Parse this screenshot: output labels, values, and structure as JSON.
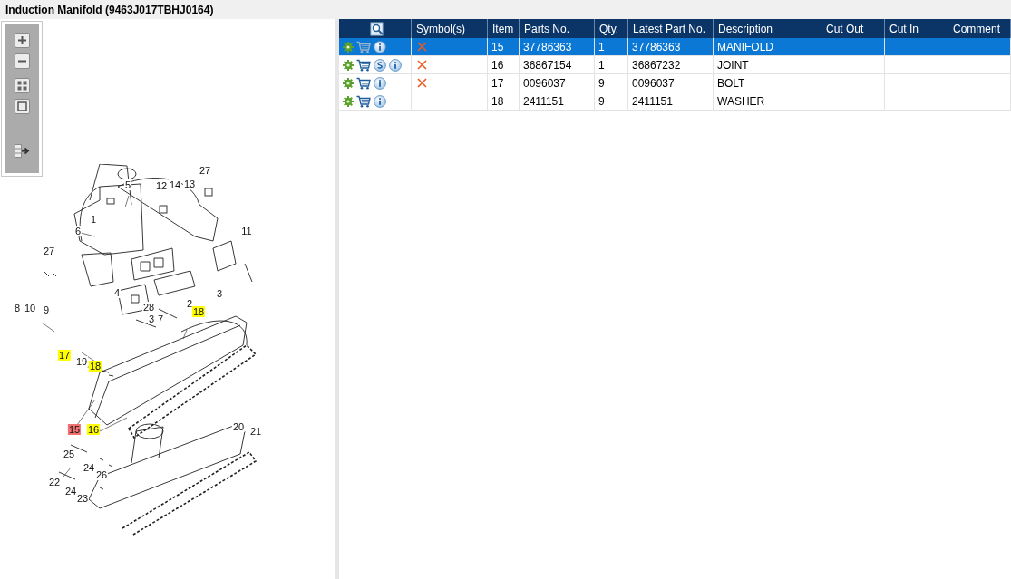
{
  "title": "Induction Manifold (9463J017TBHJ0164)",
  "callouts": [
    {
      "label": "27",
      "kind": "plain"
    },
    {
      "label": "5",
      "kind": "plain"
    },
    {
      "label": "12",
      "kind": "plain"
    },
    {
      "label": "14",
      "kind": "plain"
    },
    {
      "label": "13",
      "kind": "plain"
    },
    {
      "label": "1",
      "kind": "plain"
    },
    {
      "label": "6",
      "kind": "plain"
    },
    {
      "label": "11",
      "kind": "plain"
    },
    {
      "label": "27",
      "kind": "plain"
    },
    {
      "label": "8",
      "kind": "plain"
    },
    {
      "label": "10",
      "kind": "plain"
    },
    {
      "label": "9",
      "kind": "plain"
    },
    {
      "label": "4",
      "kind": "plain"
    },
    {
      "label": "3",
      "kind": "plain"
    },
    {
      "label": "2",
      "kind": "plain"
    },
    {
      "label": "28",
      "kind": "plain"
    },
    {
      "label": "18",
      "kind": "listed"
    },
    {
      "label": "3",
      "kind": "plain"
    },
    {
      "label": "7",
      "kind": "plain"
    },
    {
      "label": "17",
      "kind": "listed"
    },
    {
      "label": "19",
      "kind": "plain"
    },
    {
      "label": "18",
      "kind": "listed"
    },
    {
      "label": "15",
      "kind": "selected"
    },
    {
      "label": "16",
      "kind": "listed"
    },
    {
      "label": "20",
      "kind": "plain"
    },
    {
      "label": "21",
      "kind": "plain"
    },
    {
      "label": "25",
      "kind": "plain"
    },
    {
      "label": "24",
      "kind": "plain"
    },
    {
      "label": "26",
      "kind": "plain"
    },
    {
      "label": "22",
      "kind": "plain"
    },
    {
      "label": "24",
      "kind": "plain"
    },
    {
      "label": "23",
      "kind": "plain"
    }
  ],
  "table": {
    "columns": [
      "Symbol(s)",
      "Item",
      "Parts No.",
      "Qty.",
      "Latest Part No.",
      "Description",
      "Cut Out",
      "Cut In",
      "Comment"
    ],
    "rows": [
      {
        "selected": true,
        "supersession": false,
        "crossed": true,
        "item": "15",
        "part_no": "37786363",
        "qty": "1",
        "latest_part_no": "37786363",
        "description": "MANIFOLD"
      },
      {
        "selected": false,
        "supersession": true,
        "crossed": true,
        "item": "16",
        "part_no": "36867154",
        "qty": "1",
        "latest_part_no": "36867232",
        "description": "JOINT"
      },
      {
        "selected": false,
        "supersession": false,
        "crossed": true,
        "item": "17",
        "part_no": "0096037",
        "qty": "9",
        "latest_part_no": "0096037",
        "description": "BOLT"
      },
      {
        "selected": false,
        "supersession": false,
        "crossed": false,
        "item": "18",
        "part_no": "2411151",
        "qty": "9",
        "latest_part_no": "2411151",
        "description": "WASHER"
      }
    ]
  }
}
